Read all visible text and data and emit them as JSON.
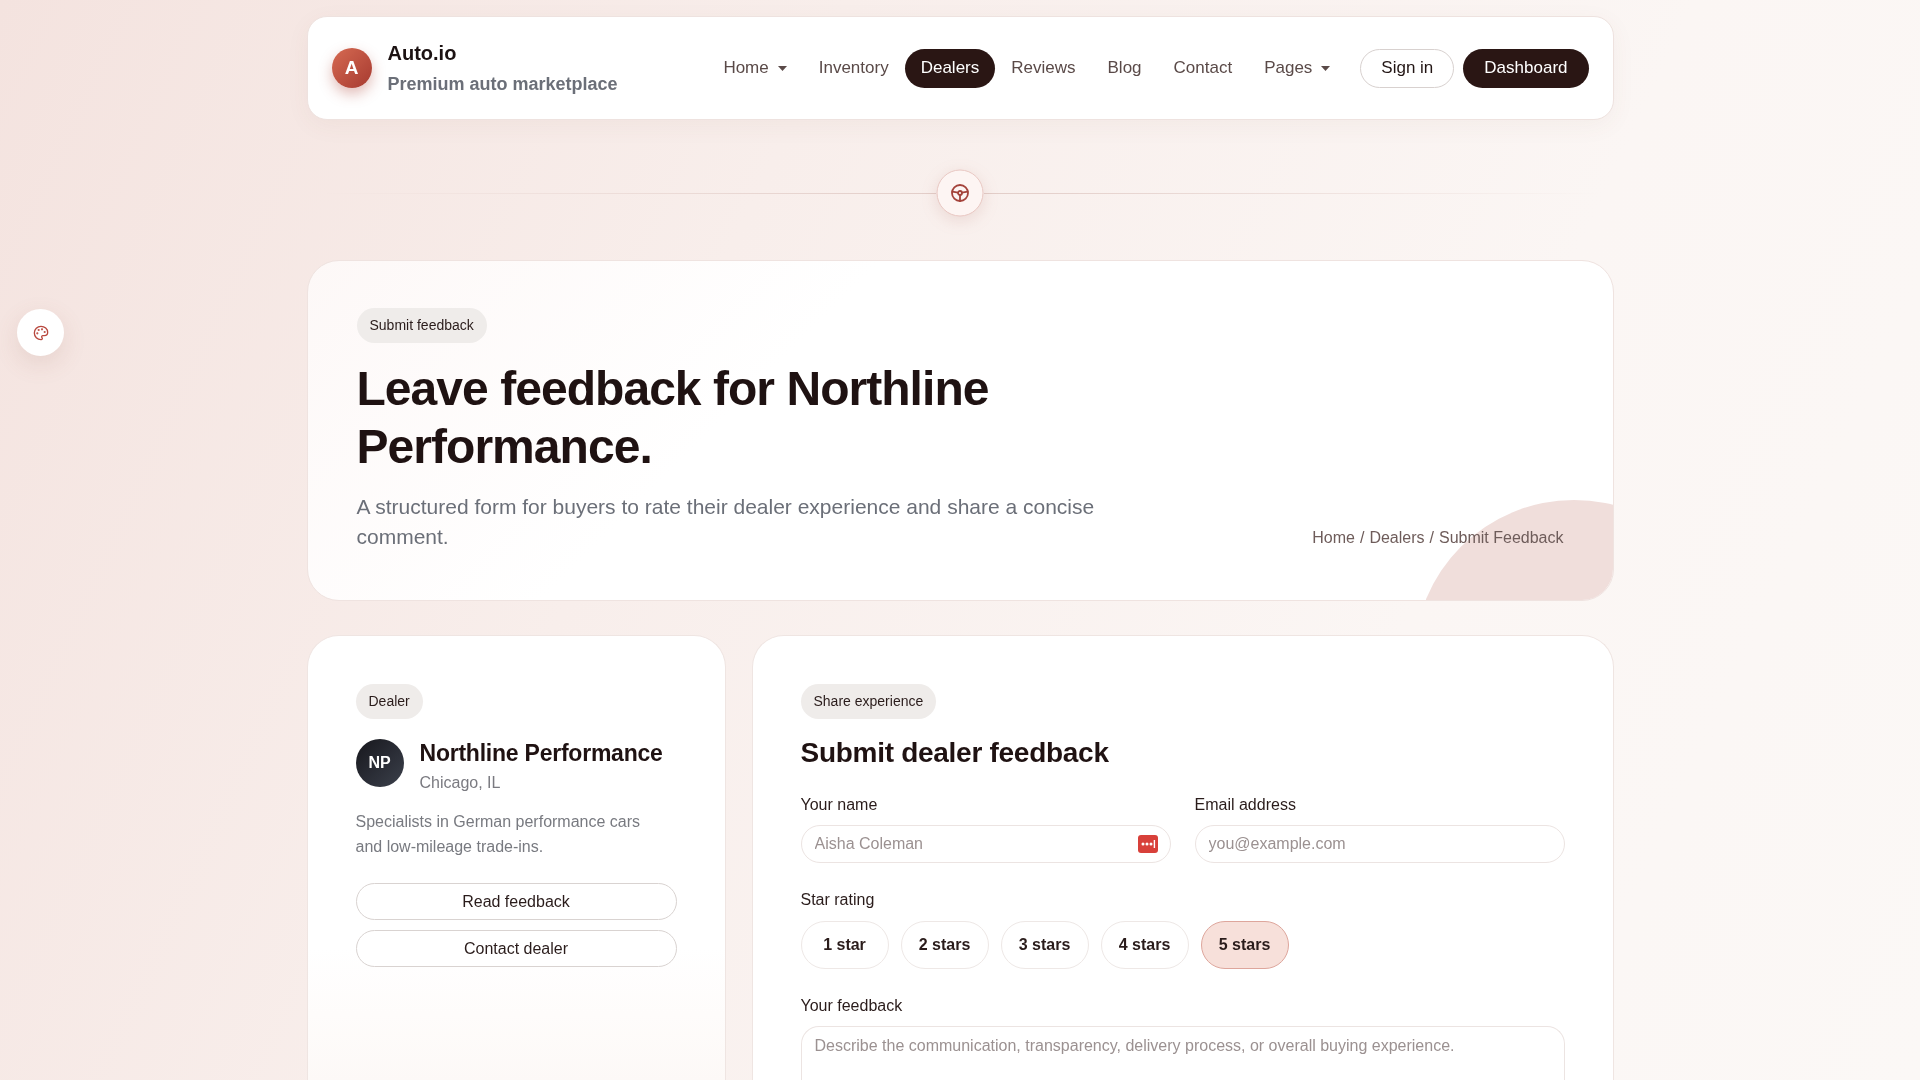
{
  "brand": {
    "logo_letter": "A",
    "name": "Auto.io",
    "tagline": "Premium auto marketplace"
  },
  "nav": [
    {
      "label": "Home",
      "dropdown": true,
      "selected": false
    },
    {
      "label": "Inventory",
      "dropdown": false,
      "selected": false
    },
    {
      "label": "Dealers",
      "dropdown": false,
      "selected": true
    },
    {
      "label": "Reviews",
      "dropdown": false,
      "selected": false
    },
    {
      "label": "Blog",
      "dropdown": false,
      "selected": false
    },
    {
      "label": "Contact",
      "dropdown": false,
      "selected": false
    },
    {
      "label": "Pages",
      "dropdown": true,
      "selected": false
    }
  ],
  "header_actions": [
    {
      "label": "Sign in",
      "kind": "outline"
    },
    {
      "label": "Dashboard",
      "kind": "solid"
    }
  ],
  "hero": {
    "badge": "Submit feedback",
    "title": "Leave feedback for Northline Performance.",
    "subtitle": "A structured form for buyers to rate their dealer experience and share a concise comment.",
    "breadcrumb": {
      "items": [
        "Home",
        "Dealers",
        "Submit Feedback"
      ],
      "separator": "/"
    }
  },
  "dealer": {
    "badge": "Dealer",
    "initials": "NP",
    "name": "Northline Performance",
    "location": "Chicago, IL",
    "description": "Specialists in German performance cars and low-mileage trade-ins.",
    "actions": [
      "Read feedback",
      "Contact dealer"
    ]
  },
  "form": {
    "badge": "Share experience",
    "title": "Submit dealer feedback",
    "fields": [
      {
        "label": "Your name",
        "placeholder": "Aisha Coleman",
        "autofill_icon": true
      },
      {
        "label": "Email address",
        "placeholder": "you@example.com"
      }
    ],
    "rating": {
      "label": "Star rating",
      "options": [
        {
          "label": "1 star",
          "selected": false
        },
        {
          "label": "2 stars",
          "selected": false
        },
        {
          "label": "3 stars",
          "selected": false
        },
        {
          "label": "4 stars",
          "selected": false
        },
        {
          "label": "5 stars",
          "selected": true
        }
      ]
    },
    "feedback": {
      "label": "Your feedback",
      "placeholder": "Describe the communication, transparency, delivery process, or overall buying experience."
    }
  }
}
